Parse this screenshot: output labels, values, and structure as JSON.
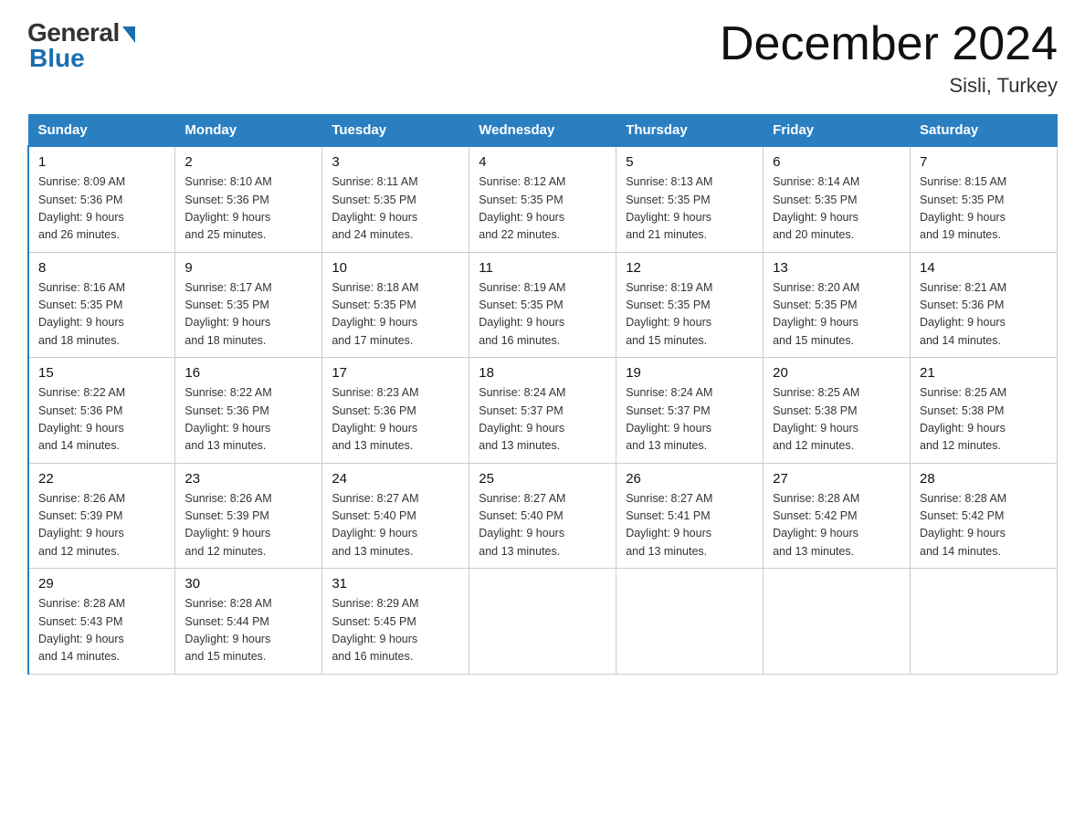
{
  "header": {
    "logo_general": "General",
    "logo_blue": "Blue",
    "title": "December 2024",
    "subtitle": "Sisli, Turkey"
  },
  "days_of_week": [
    "Sunday",
    "Monday",
    "Tuesday",
    "Wednesday",
    "Thursday",
    "Friday",
    "Saturday"
  ],
  "weeks": [
    [
      {
        "day": "1",
        "sunrise": "8:09 AM",
        "sunset": "5:36 PM",
        "daylight": "9 hours and 26 minutes."
      },
      {
        "day": "2",
        "sunrise": "8:10 AM",
        "sunset": "5:36 PM",
        "daylight": "9 hours and 25 minutes."
      },
      {
        "day": "3",
        "sunrise": "8:11 AM",
        "sunset": "5:35 PM",
        "daylight": "9 hours and 24 minutes."
      },
      {
        "day": "4",
        "sunrise": "8:12 AM",
        "sunset": "5:35 PM",
        "daylight": "9 hours and 22 minutes."
      },
      {
        "day": "5",
        "sunrise": "8:13 AM",
        "sunset": "5:35 PM",
        "daylight": "9 hours and 21 minutes."
      },
      {
        "day": "6",
        "sunrise": "8:14 AM",
        "sunset": "5:35 PM",
        "daylight": "9 hours and 20 minutes."
      },
      {
        "day": "7",
        "sunrise": "8:15 AM",
        "sunset": "5:35 PM",
        "daylight": "9 hours and 19 minutes."
      }
    ],
    [
      {
        "day": "8",
        "sunrise": "8:16 AM",
        "sunset": "5:35 PM",
        "daylight": "9 hours and 18 minutes."
      },
      {
        "day": "9",
        "sunrise": "8:17 AM",
        "sunset": "5:35 PM",
        "daylight": "9 hours and 18 minutes."
      },
      {
        "day": "10",
        "sunrise": "8:18 AM",
        "sunset": "5:35 PM",
        "daylight": "9 hours and 17 minutes."
      },
      {
        "day": "11",
        "sunrise": "8:19 AM",
        "sunset": "5:35 PM",
        "daylight": "9 hours and 16 minutes."
      },
      {
        "day": "12",
        "sunrise": "8:19 AM",
        "sunset": "5:35 PM",
        "daylight": "9 hours and 15 minutes."
      },
      {
        "day": "13",
        "sunrise": "8:20 AM",
        "sunset": "5:35 PM",
        "daylight": "9 hours and 15 minutes."
      },
      {
        "day": "14",
        "sunrise": "8:21 AM",
        "sunset": "5:36 PM",
        "daylight": "9 hours and 14 minutes."
      }
    ],
    [
      {
        "day": "15",
        "sunrise": "8:22 AM",
        "sunset": "5:36 PM",
        "daylight": "9 hours and 14 minutes."
      },
      {
        "day": "16",
        "sunrise": "8:22 AM",
        "sunset": "5:36 PM",
        "daylight": "9 hours and 13 minutes."
      },
      {
        "day": "17",
        "sunrise": "8:23 AM",
        "sunset": "5:36 PM",
        "daylight": "9 hours and 13 minutes."
      },
      {
        "day": "18",
        "sunrise": "8:24 AM",
        "sunset": "5:37 PM",
        "daylight": "9 hours and 13 minutes."
      },
      {
        "day": "19",
        "sunrise": "8:24 AM",
        "sunset": "5:37 PM",
        "daylight": "9 hours and 13 minutes."
      },
      {
        "day": "20",
        "sunrise": "8:25 AM",
        "sunset": "5:38 PM",
        "daylight": "9 hours and 12 minutes."
      },
      {
        "day": "21",
        "sunrise": "8:25 AM",
        "sunset": "5:38 PM",
        "daylight": "9 hours and 12 minutes."
      }
    ],
    [
      {
        "day": "22",
        "sunrise": "8:26 AM",
        "sunset": "5:39 PM",
        "daylight": "9 hours and 12 minutes."
      },
      {
        "day": "23",
        "sunrise": "8:26 AM",
        "sunset": "5:39 PM",
        "daylight": "9 hours and 12 minutes."
      },
      {
        "day": "24",
        "sunrise": "8:27 AM",
        "sunset": "5:40 PM",
        "daylight": "9 hours and 13 minutes."
      },
      {
        "day": "25",
        "sunrise": "8:27 AM",
        "sunset": "5:40 PM",
        "daylight": "9 hours and 13 minutes."
      },
      {
        "day": "26",
        "sunrise": "8:27 AM",
        "sunset": "5:41 PM",
        "daylight": "9 hours and 13 minutes."
      },
      {
        "day": "27",
        "sunrise": "8:28 AM",
        "sunset": "5:42 PM",
        "daylight": "9 hours and 13 minutes."
      },
      {
        "day": "28",
        "sunrise": "8:28 AM",
        "sunset": "5:42 PM",
        "daylight": "9 hours and 14 minutes."
      }
    ],
    [
      {
        "day": "29",
        "sunrise": "8:28 AM",
        "sunset": "5:43 PM",
        "daylight": "9 hours and 14 minutes."
      },
      {
        "day": "30",
        "sunrise": "8:28 AM",
        "sunset": "5:44 PM",
        "daylight": "9 hours and 15 minutes."
      },
      {
        "day": "31",
        "sunrise": "8:29 AM",
        "sunset": "5:45 PM",
        "daylight": "9 hours and 16 minutes."
      },
      null,
      null,
      null,
      null
    ]
  ],
  "labels": {
    "sunrise": "Sunrise:",
    "sunset": "Sunset:",
    "daylight": "Daylight:"
  }
}
